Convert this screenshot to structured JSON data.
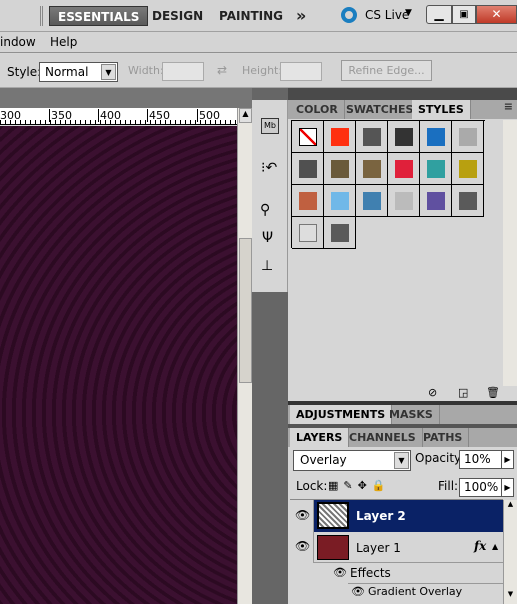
{
  "workspace": {
    "items": [
      "ESSENTIALS",
      "DESIGN",
      "PAINTING"
    ],
    "more": "»",
    "cs_live": "CS Live"
  },
  "menu": [
    "indow",
    "Help"
  ],
  "options": {
    "style_label": "Style:",
    "style_value": "Normal",
    "width_label": "Width:",
    "height_label": "Height:",
    "refine_edge": "Refine Edge..."
  },
  "ruler": [
    "300",
    "350",
    "400",
    "450",
    "500"
  ],
  "styles_panel": {
    "tabs": [
      "COLOR",
      "SWATCHES",
      "STYLES"
    ],
    "active_tab": "STYLES",
    "swatches": [
      "#ffffff",
      "#ff3010",
      "#555555",
      "#333333",
      "#1a6fc0",
      "#aaaaaa",
      "#505050",
      "#6a5a3a",
      "#7a6440",
      "#e0203a",
      "#30a0a0",
      "#b8a010",
      "#c06040",
      "#70b8e8",
      "#4080b0",
      "#bbbbbb",
      "#6050a0",
      "#5a5a5a",
      "#dddddd",
      "#5a5a5a"
    ]
  },
  "adjustments_panel": {
    "tabs": [
      "ADJUSTMENTS",
      "MASKS"
    ]
  },
  "layers_panel": {
    "tabs": [
      "LAYERS",
      "CHANNELS",
      "PATHS"
    ],
    "blend_mode": "Overlay",
    "opacity_label": "Opacity:",
    "opacity": "10%",
    "lock_label": "Lock:",
    "fill_label": "Fill:",
    "fill": "100%",
    "layers": [
      {
        "name": "Layer 2",
        "selected": true
      },
      {
        "name": "Layer 1",
        "fx": "fx",
        "color": "#7a1c24"
      }
    ],
    "effects_label": "Effects",
    "effect": "Gradient Overlay"
  },
  "colors": {
    "selected_row": "#0a2266",
    "canvas": "#3b1030"
  }
}
